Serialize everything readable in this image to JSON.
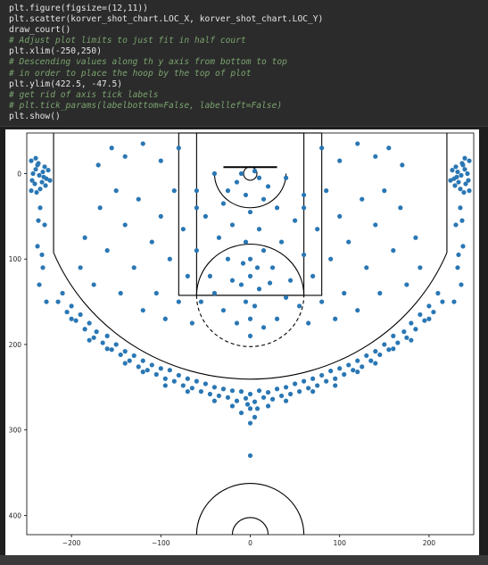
{
  "code_lines": [
    "plt.figure(figsize=(12,11))",
    "plt.scatter(korver_shot_chart.LOC_X, korver_shot_chart.LOC_Y)",
    "draw_court()",
    "# Adjust plot limits to just fit in half court",
    "plt.xlim(-250,250)",
    "# Descending values along th y axis from bottom to top",
    "# in order to place the hoop by the top of plot",
    "plt.ylim(422.5, -47.5)",
    "# get rid of axis tick labels",
    "# plt.tick_params(labelbottom=False, labelleft=False)",
    "plt.show()"
  ],
  "colors": {
    "point": "#2a77b4",
    "court_line": "#000000"
  },
  "chart_data": {
    "type": "scatter",
    "title": "",
    "xlabel": "",
    "ylabel": "",
    "xlim": [
      -250,
      250
    ],
    "ylim": [
      422.5,
      -47.5
    ],
    "x_ticks": [
      -200,
      -100,
      0,
      100,
      200
    ],
    "x_tick_labels": [
      "−200",
      "−100",
      "0",
      "100",
      "200"
    ],
    "y_ticks": [
      0,
      100,
      200,
      300,
      400
    ],
    "y_tick_labels": [
      "0",
      "100",
      "200",
      "300",
      "400"
    ],
    "grid": false,
    "series": [
      {
        "points": [
          [
            -245,
            -15
          ],
          [
            -240,
            -5
          ],
          [
            -236,
            2
          ],
          [
            -244,
            8
          ],
          [
            -238,
            -10
          ],
          [
            -232,
            -2
          ],
          [
            -228,
            6
          ],
          [
            -241,
            12
          ],
          [
            -235,
            18
          ],
          [
            -230,
            -8
          ],
          [
            -245,
            20
          ],
          [
            -233,
            10
          ],
          [
            -226,
            -4
          ],
          [
            -240,
            -18
          ],
          [
            -229,
            14
          ],
          [
            -243,
            0
          ],
          [
            -237,
            -12
          ],
          [
            -231,
            4
          ],
          [
            -224,
            8
          ],
          [
            -239,
            22
          ],
          [
            245,
            -15
          ],
          [
            240,
            -5
          ],
          [
            236,
            2
          ],
          [
            244,
            8
          ],
          [
            238,
            -10
          ],
          [
            232,
            -2
          ],
          [
            228,
            6
          ],
          [
            241,
            12
          ],
          [
            235,
            18
          ],
          [
            230,
            -8
          ],
          [
            245,
            20
          ],
          [
            233,
            10
          ],
          [
            226,
            -4
          ],
          [
            240,
            -18
          ],
          [
            229,
            14
          ],
          [
            243,
            0
          ],
          [
            237,
            -12
          ],
          [
            231,
            4
          ],
          [
            224,
            8
          ],
          [
            239,
            22
          ],
          [
            -235,
            40
          ],
          [
            -230,
            60
          ],
          [
            -238,
            85
          ],
          [
            -232,
            110
          ],
          [
            -236,
            130
          ],
          [
            -228,
            150
          ],
          [
            -233,
            95
          ],
          [
            -237,
            55
          ],
          [
            235,
            40
          ],
          [
            230,
            60
          ],
          [
            238,
            85
          ],
          [
            232,
            110
          ],
          [
            236,
            130
          ],
          [
            228,
            150
          ],
          [
            233,
            95
          ],
          [
            237,
            55
          ],
          [
            -210,
            140
          ],
          [
            -200,
            155
          ],
          [
            -190,
            165
          ],
          [
            -180,
            175
          ],
          [
            -172,
            185
          ],
          [
            -160,
            190
          ],
          [
            -150,
            200
          ],
          [
            -140,
            208
          ],
          [
            -130,
            213
          ],
          [
            -120,
            219
          ],
          [
            -110,
            224
          ],
          [
            -100,
            228
          ],
          [
            -90,
            230
          ],
          [
            -80,
            236
          ],
          [
            -70,
            240
          ],
          [
            -60,
            243
          ],
          [
            -50,
            246
          ],
          [
            -40,
            250
          ],
          [
            -30,
            252
          ],
          [
            -20,
            254
          ],
          [
            -10,
            255
          ],
          [
            0,
            258
          ],
          [
            10,
            254
          ],
          [
            20,
            256
          ],
          [
            30,
            252
          ],
          [
            40,
            250
          ],
          [
            50,
            246
          ],
          [
            60,
            243
          ],
          [
            70,
            240
          ],
          [
            80,
            236
          ],
          [
            90,
            231
          ],
          [
            100,
            228
          ],
          [
            110,
            224
          ],
          [
            120,
            219
          ],
          [
            130,
            213
          ],
          [
            140,
            208
          ],
          [
            150,
            200
          ],
          [
            160,
            190
          ],
          [
            172,
            185
          ],
          [
            180,
            175
          ],
          [
            190,
            165
          ],
          [
            200,
            155
          ],
          [
            210,
            140
          ],
          [
            -215,
            150
          ],
          [
            -205,
            162
          ],
          [
            -195,
            172
          ],
          [
            -185,
            182
          ],
          [
            -175,
            192
          ],
          [
            -165,
            198
          ],
          [
            -155,
            206
          ],
          [
            -145,
            212
          ],
          [
            -135,
            219
          ],
          [
            -125,
            226
          ],
          [
            -115,
            230
          ],
          [
            -105,
            235
          ],
          [
            -95,
            240
          ],
          [
            -85,
            243
          ],
          [
            -75,
            248
          ],
          [
            -65,
            251
          ],
          [
            -55,
            255
          ],
          [
            -45,
            258
          ],
          [
            -35,
            260
          ],
          [
            -25,
            262
          ],
          [
            -15,
            266
          ],
          [
            -5,
            263
          ],
          [
            5,
            267
          ],
          [
            15,
            262
          ],
          [
            25,
            264
          ],
          [
            35,
            260
          ],
          [
            45,
            258
          ],
          [
            55,
            255
          ],
          [
            65,
            251
          ],
          [
            75,
            248
          ],
          [
            85,
            243
          ],
          [
            95,
            240
          ],
          [
            105,
            235
          ],
          [
            115,
            230
          ],
          [
            125,
            226
          ],
          [
            135,
            219
          ],
          [
            145,
            212
          ],
          [
            155,
            206
          ],
          [
            165,
            198
          ],
          [
            175,
            192
          ],
          [
            185,
            182
          ],
          [
            195,
            172
          ],
          [
            205,
            162
          ],
          [
            215,
            150
          ],
          [
            -200,
            170
          ],
          [
            -180,
            195
          ],
          [
            -160,
            205
          ],
          [
            -140,
            222
          ],
          [
            -120,
            232
          ],
          [
            -95,
            248
          ],
          [
            -70,
            255
          ],
          [
            -40,
            266
          ],
          [
            -20,
            272
          ],
          [
            0,
            275
          ],
          [
            20,
            272
          ],
          [
            40,
            266
          ],
          [
            70,
            255
          ],
          [
            95,
            248
          ],
          [
            120,
            232
          ],
          [
            140,
            222
          ],
          [
            160,
            205
          ],
          [
            180,
            195
          ],
          [
            200,
            170
          ],
          [
            -10,
            280
          ],
          [
            5,
            285
          ],
          [
            0,
            292
          ],
          [
            -3,
            270
          ],
          [
            8,
            275
          ],
          [
            0,
            330
          ],
          [
            -190,
            110
          ],
          [
            -185,
            75
          ],
          [
            -175,
            130
          ],
          [
            -168,
            40
          ],
          [
            -160,
            90
          ],
          [
            -150,
            20
          ],
          [
            -145,
            140
          ],
          [
            -140,
            60
          ],
          [
            -130,
            110
          ],
          [
            -125,
            30
          ],
          [
            -120,
            160
          ],
          [
            -110,
            80
          ],
          [
            -105,
            140
          ],
          [
            -100,
            50
          ],
          [
            -95,
            170
          ],
          [
            -90,
            100
          ],
          [
            -85,
            20
          ],
          [
            -80,
            150
          ],
          [
            -75,
            65
          ],
          [
            -70,
            120
          ],
          [
            -65,
            175
          ],
          [
            -60,
            40
          ],
          [
            -155,
            -30
          ],
          [
            -140,
            -20
          ],
          [
            -120,
            -35
          ],
          [
            -100,
            -15
          ],
          [
            -80,
            -30
          ],
          [
            -170,
            -10
          ],
          [
            190,
            110
          ],
          [
            185,
            75
          ],
          [
            175,
            130
          ],
          [
            168,
            40
          ],
          [
            160,
            90
          ],
          [
            150,
            20
          ],
          [
            145,
            140
          ],
          [
            140,
            60
          ],
          [
            130,
            110
          ],
          [
            125,
            30
          ],
          [
            120,
            160
          ],
          [
            110,
            80
          ],
          [
            105,
            140
          ],
          [
            100,
            50
          ],
          [
            95,
            170
          ],
          [
            90,
            100
          ],
          [
            85,
            20
          ],
          [
            80,
            150
          ],
          [
            75,
            65
          ],
          [
            70,
            120
          ],
          [
            65,
            175
          ],
          [
            60,
            40
          ],
          [
            155,
            -30
          ],
          [
            140,
            -20
          ],
          [
            120,
            -35
          ],
          [
            100,
            -15
          ],
          [
            80,
            -30
          ],
          [
            170,
            -10
          ],
          [
            -10,
            0
          ],
          [
            5,
            -3
          ],
          [
            10,
            5
          ],
          [
            -15,
            10
          ],
          [
            20,
            15
          ],
          [
            -25,
            20
          ],
          [
            -5,
            25
          ],
          [
            15,
            30
          ],
          [
            -30,
            35
          ],
          [
            30,
            40
          ],
          [
            0,
            45
          ],
          [
            -20,
            60
          ],
          [
            10,
            65
          ],
          [
            -5,
            80
          ],
          [
            15,
            90
          ],
          [
            -25,
            100
          ],
          [
            25,
            110
          ],
          [
            0,
            120
          ],
          [
            -10,
            130
          ],
          [
            10,
            135
          ],
          [
            -40,
            140
          ],
          [
            40,
            145
          ],
          [
            -30,
            160
          ],
          [
            30,
            170
          ],
          [
            -15,
            175
          ],
          [
            15,
            180
          ],
          [
            0,
            190
          ],
          [
            -50,
            50
          ],
          [
            50,
            55
          ],
          [
            -45,
            120
          ],
          [
            45,
            125
          ],
          [
            -60,
            90
          ],
          [
            60,
            95
          ],
          [
            -35,
            75
          ],
          [
            35,
            80
          ],
          [
            -55,
            150
          ],
          [
            55,
            155
          ],
          [
            -5,
            150
          ],
          [
            5,
            155
          ],
          [
            0,
            170
          ],
          [
            -20,
            125
          ],
          [
            22,
            128
          ],
          [
            8,
            110
          ],
          [
            -8,
            105
          ],
          [
            0,
            100
          ],
          [
            -60,
            20
          ],
          [
            60,
            25
          ],
          [
            -40,
            0
          ],
          [
            40,
            5
          ]
        ]
      }
    ]
  }
}
